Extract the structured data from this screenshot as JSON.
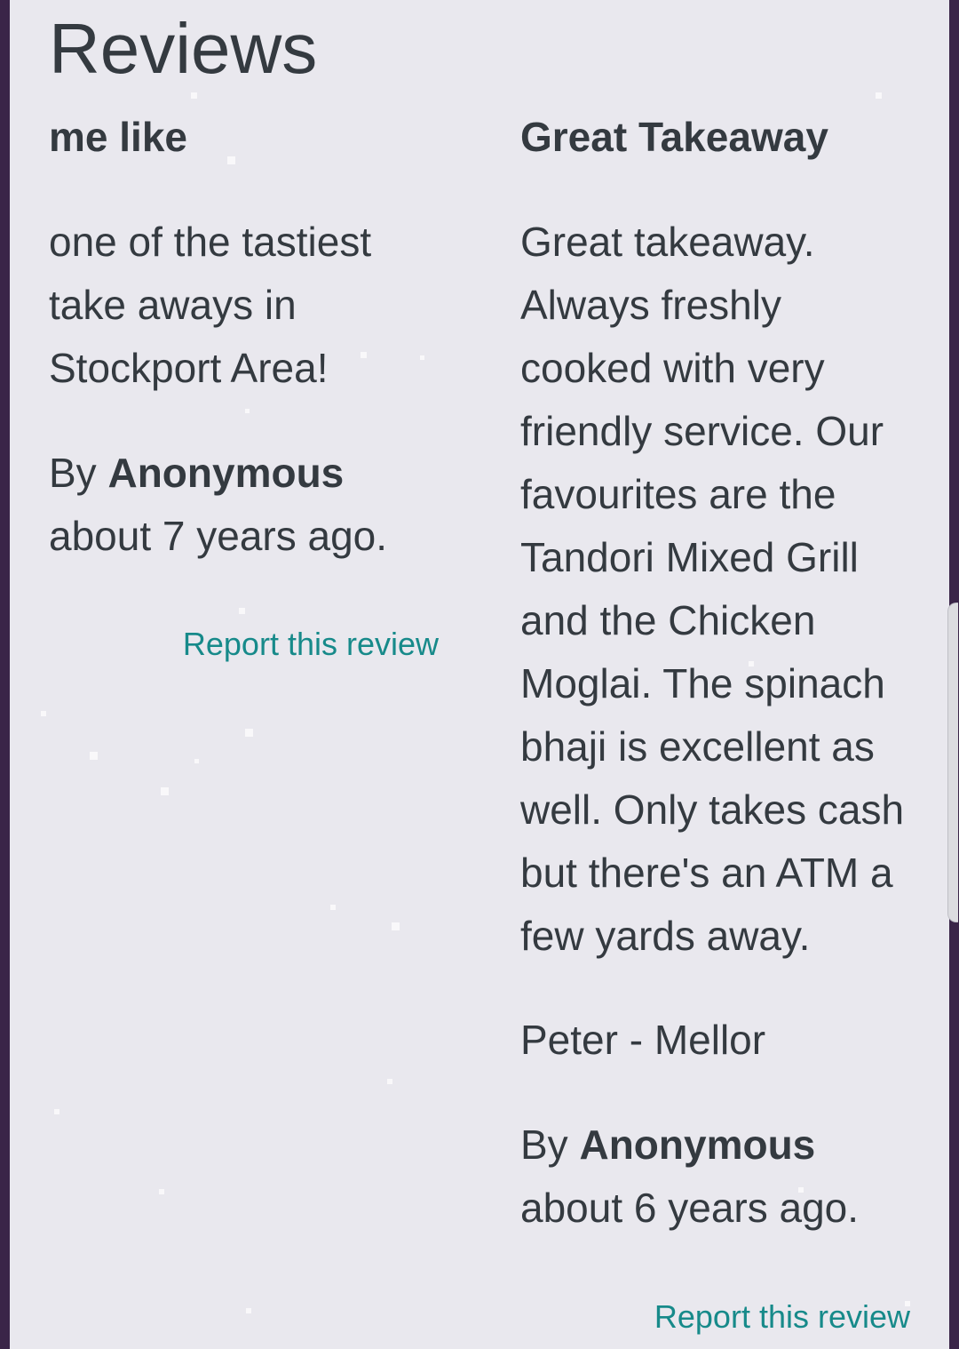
{
  "page": {
    "title": "Reviews"
  },
  "reviews": [
    {
      "title": "me like",
      "body_lines": [
        "one of the tastiest",
        "take aways in",
        "Stockport Area!"
      ],
      "by_prefix": "By",
      "author": "Anonymous",
      "time": "about 7 years ago.",
      "report_label": "Report this review"
    },
    {
      "title": "Great Takeaway",
      "body_lines": [
        "Great takeaway.",
        "Always freshly",
        "cooked with very",
        "friendly service. Our",
        "favourites are the",
        "Tandori Mixed Grill",
        "and the Chicken",
        "Moglai. The spinach",
        "bhaji is excellent as",
        "well. Only takes cash",
        "but there's an ATM a",
        "few yards away."
      ],
      "signature": "Peter - Mellor",
      "by_prefix": "By",
      "author": "Anonymous",
      "time": "about 6 years ago.",
      "report_label": "Report this review"
    }
  ],
  "colors": {
    "background_frame": "#3a2548",
    "panel": "#e9e8ee",
    "text": "#343a40",
    "link": "#178a8a"
  }
}
